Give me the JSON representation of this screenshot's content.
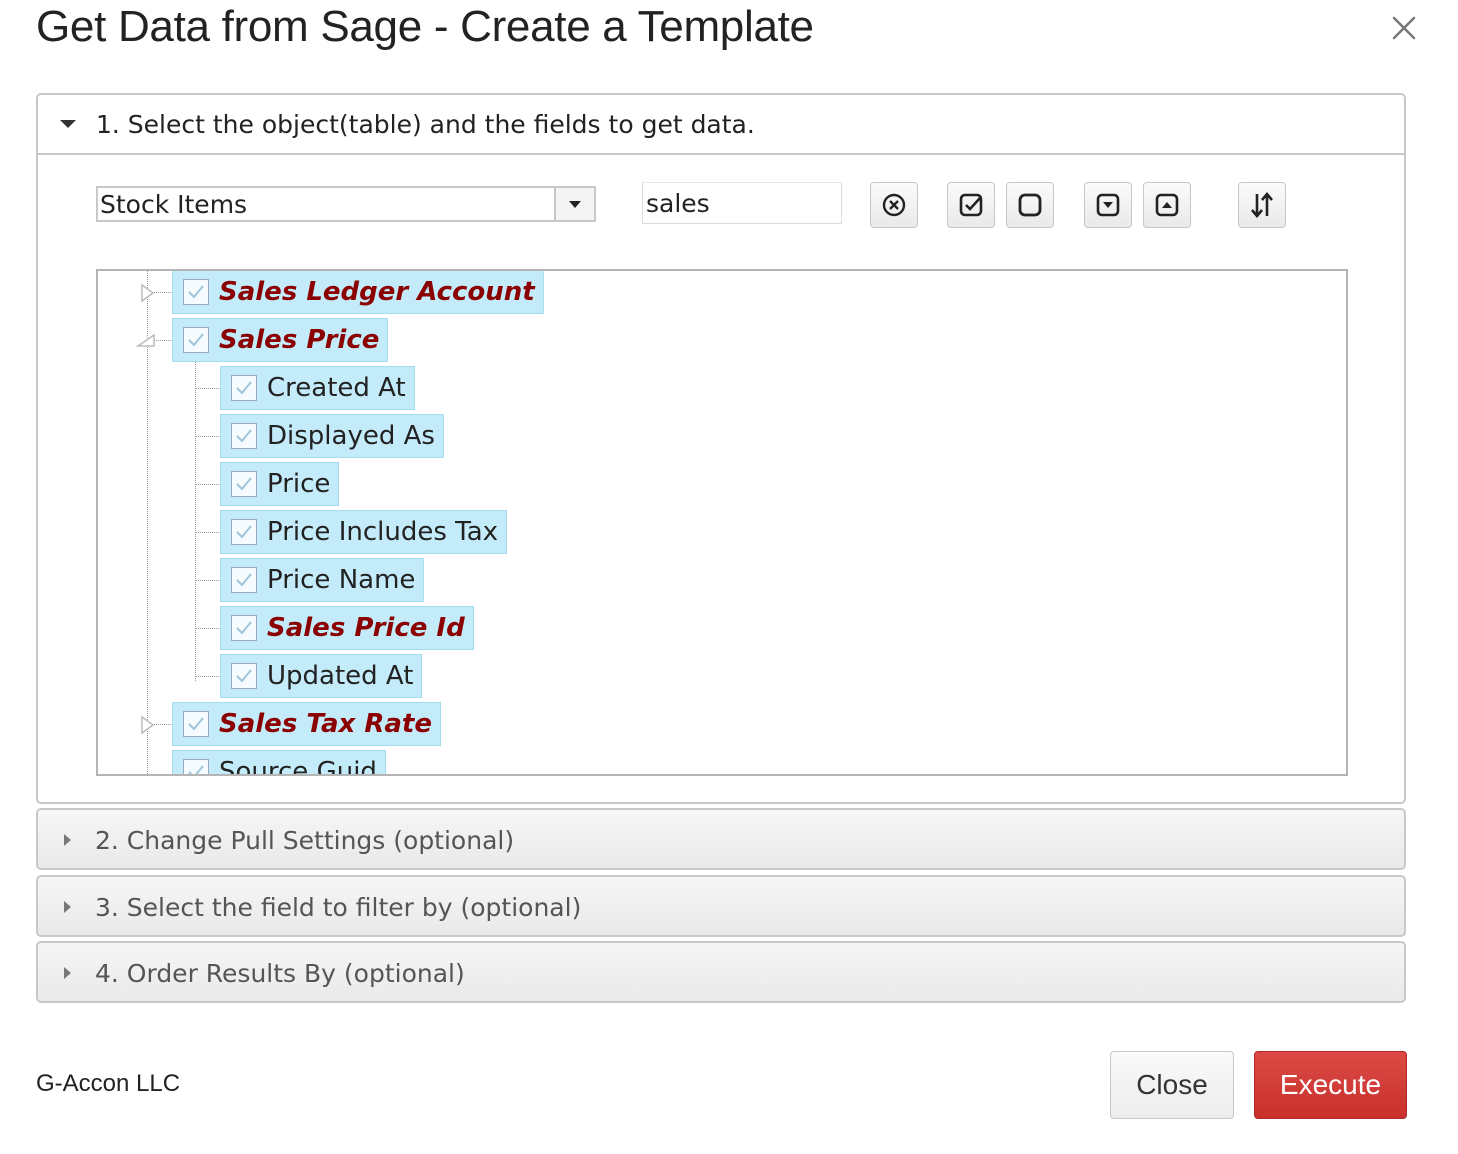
{
  "dialog": {
    "title": "Get Data from Sage - Create a Template",
    "close_icon": "close-icon"
  },
  "sections": [
    {
      "label": "1. Select the object(table) and the fields to get data.",
      "expanded": true
    },
    {
      "label": "2. Change Pull Settings (optional)",
      "expanded": false
    },
    {
      "label": "3. Select the field to filter by (optional)",
      "expanded": false
    },
    {
      "label": "4. Order Results By (optional)",
      "expanded": false
    }
  ],
  "toolbar": {
    "object_select_value": "Stock Items",
    "search_value": "sales",
    "buttons": [
      {
        "icon": "clear-circle-x-icon"
      },
      {
        "icon": "check-all-icon"
      },
      {
        "icon": "uncheck-all-icon"
      },
      {
        "icon": "expand-all-icon"
      },
      {
        "icon": "collapse-all-icon"
      },
      {
        "icon": "sort-icon"
      }
    ]
  },
  "tree": {
    "nodes": [
      {
        "label": "Sales Ledger Account",
        "checked": true,
        "key": true,
        "level": 0,
        "expander": "collapsed"
      },
      {
        "label": "Sales Price",
        "checked": true,
        "key": true,
        "level": 0,
        "expander": "expanded"
      },
      {
        "label": "Created At",
        "checked": true,
        "key": false,
        "level": 1
      },
      {
        "label": "Displayed As",
        "checked": true,
        "key": false,
        "level": 1
      },
      {
        "label": "Price",
        "checked": true,
        "key": false,
        "level": 1
      },
      {
        "label": "Price Includes Tax",
        "checked": true,
        "key": false,
        "level": 1
      },
      {
        "label": "Price Name",
        "checked": true,
        "key": false,
        "level": 1
      },
      {
        "label": "Sales Price Id",
        "checked": true,
        "key": true,
        "level": 1
      },
      {
        "label": "Updated At",
        "checked": true,
        "key": false,
        "level": 1
      },
      {
        "label": "Sales Tax Rate",
        "checked": true,
        "key": true,
        "level": 0,
        "expander": "collapsed"
      },
      {
        "label": "Source Guid",
        "checked": true,
        "key": false,
        "level": 0
      }
    ]
  },
  "footer": {
    "brand": "G-Accon LLC",
    "close_label": "Close",
    "execute_label": "Execute"
  },
  "colors": {
    "key_field_text": "#8b0000",
    "node_highlight": "#c4ebfa",
    "execute_button": "#d03a36"
  }
}
